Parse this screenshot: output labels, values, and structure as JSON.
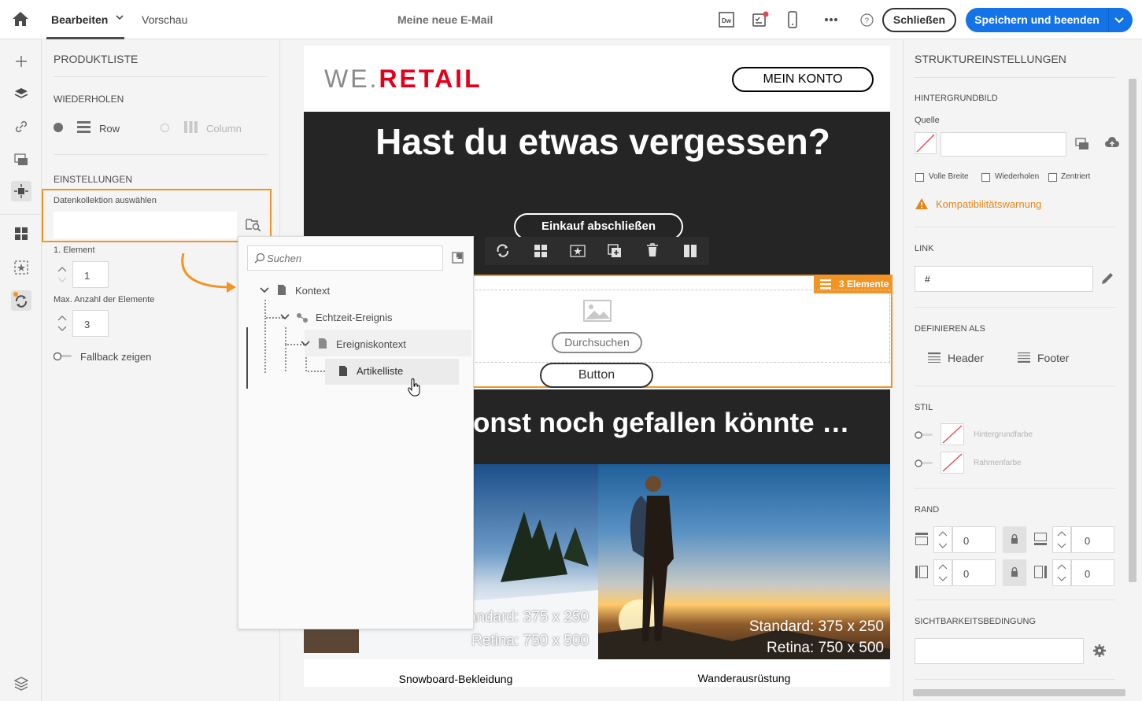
{
  "topbar": {
    "tabs": [
      "Bearbeiten",
      "Vorschau"
    ],
    "title": "Meine neue E-Mail",
    "close_label": "Schließen",
    "save_label": "Speichern und beenden"
  },
  "left_panel": {
    "title": "PRODUKTLISTE",
    "repeat_section": "WIEDERHOLEN",
    "repeat_row": "Row",
    "repeat_column": "Column",
    "settings_section": "EINSTELLUNGEN",
    "collection_label": "Datenkollektion auswählen",
    "first_element_label": "1. Element",
    "first_element_value": "1",
    "max_elements_label": "Max. Anzahl der Elemente",
    "max_elements_value": "3",
    "fallback_label": "Fallback zeigen"
  },
  "popup": {
    "search_placeholder": "Suchen",
    "tree": [
      "Kontext",
      "Echtzeit-Ereignis",
      "Ereigniskontext",
      "Artikelliste"
    ]
  },
  "email": {
    "logo_we": "WE.",
    "logo_retail": "RETAIL",
    "my_account": "MEIN KONTO",
    "headline": "Hast du etwas vergessen?",
    "cta": "Einkauf abschließen",
    "selection_badge": "3 Elemente",
    "browse": "Durchsuchen",
    "button": "Button",
    "subheadline": "onst noch gefallen könnte …",
    "image_std": "Standard: 375 x 250",
    "image_retina": "Retina: 750 x 500",
    "caption_left": "Snowboard-Bekleidung",
    "caption_right": "Wanderausrüstung"
  },
  "right_panel": {
    "title": "STRUKTUREINSTELLUNGEN",
    "bg_section": "HINTERGRUNDBILD",
    "source_label": "Quelle",
    "full_width": "Volle Breite",
    "repeat": "Wiederholen",
    "centered": "Zentriert",
    "warning": "Kompatibilitätswarnung",
    "link_section": "LINK",
    "link_value": "#",
    "define_section": "DEFINIEREN ALS",
    "header_label": "Header",
    "footer_label": "Footer",
    "style_section": "STIL",
    "bg_color": "Hintergrundfarbe",
    "border_color": "Rahmenfarbe",
    "border_section": "RAND",
    "border_values": [
      "0",
      "0",
      "0",
      "0"
    ],
    "visibility_section": "SICHTBARKEITSBEDINGUNG"
  },
  "colors": {
    "accent_blue": "#1473e6",
    "selection_orange": "#f29423",
    "logo_red": "#e4001b",
    "dark_band": "#252525"
  }
}
